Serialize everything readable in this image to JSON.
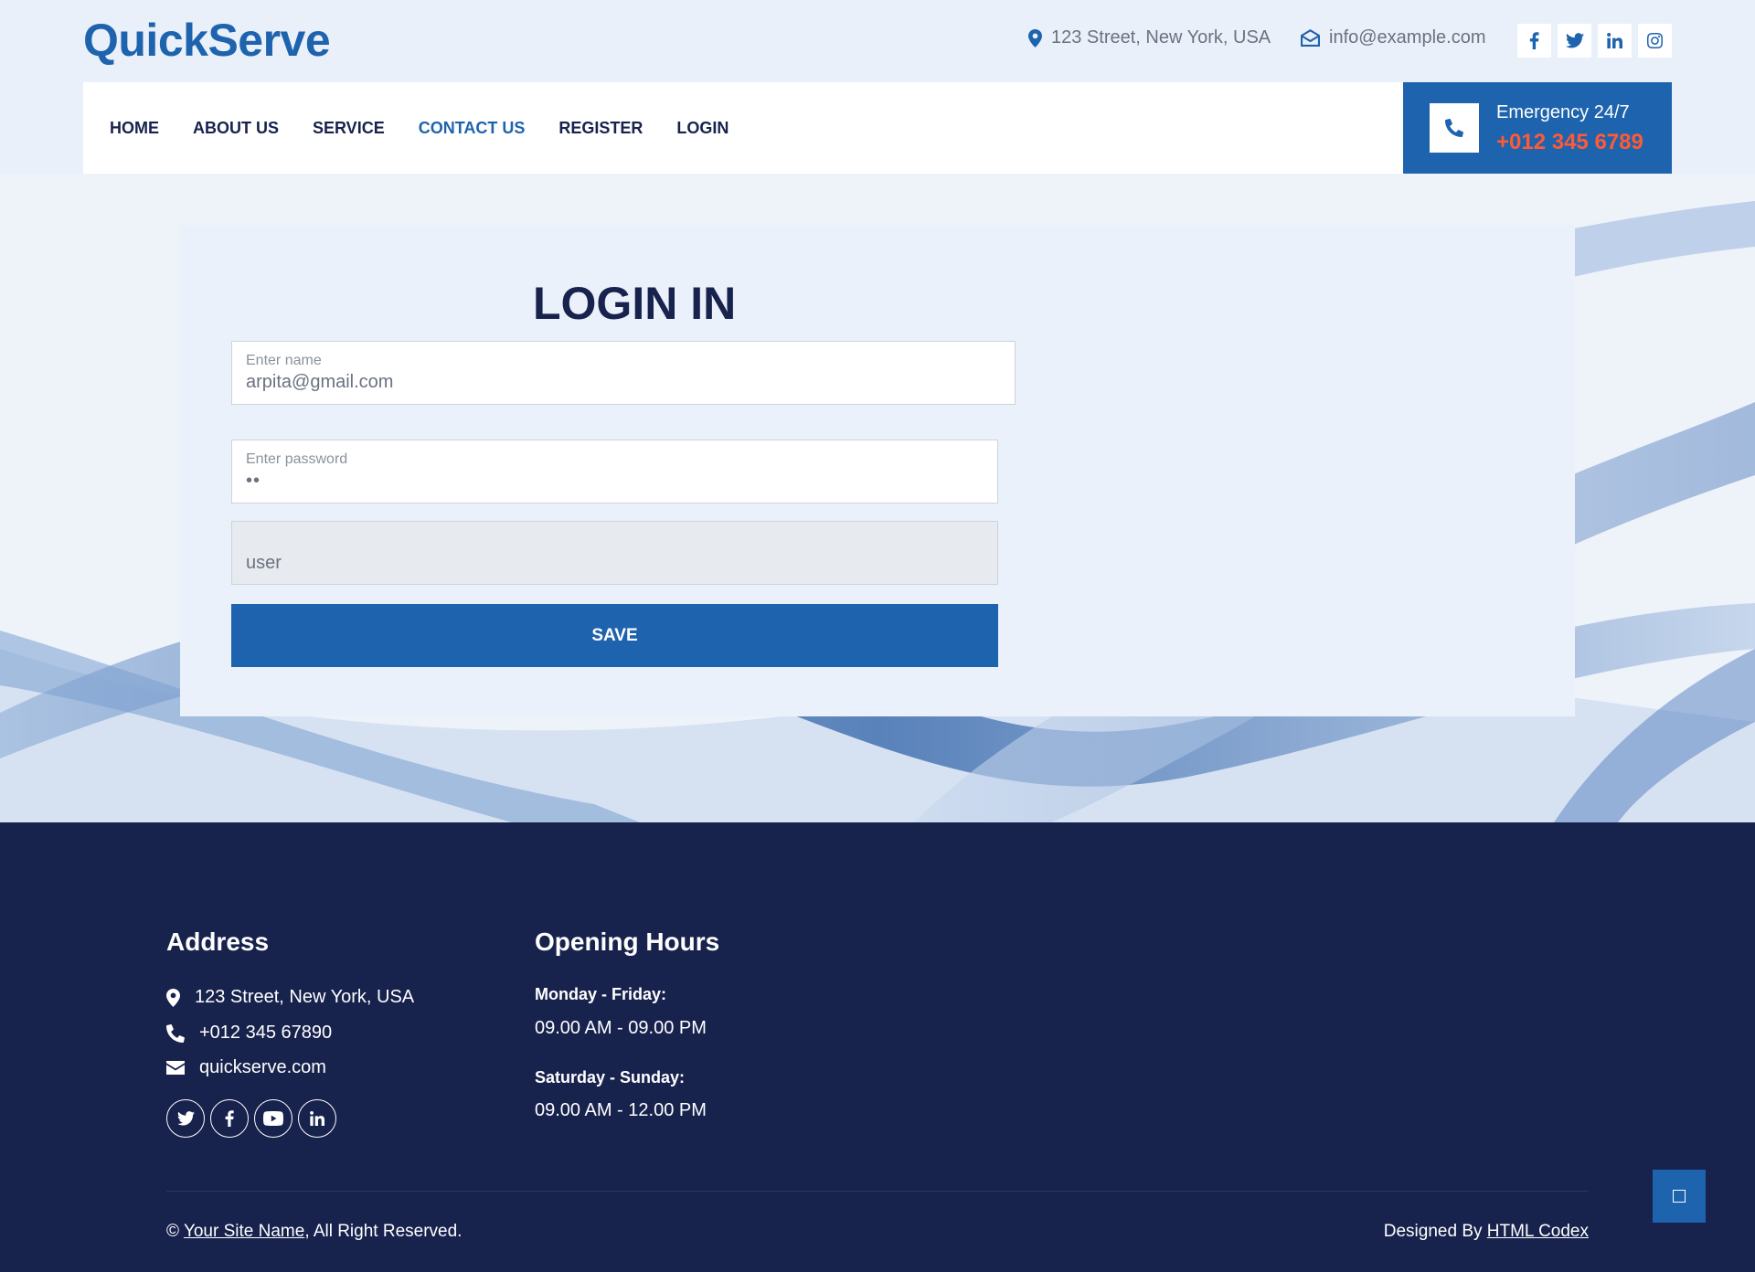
{
  "brand": {
    "name": "QuickServe"
  },
  "top_info": {
    "address": "123 Street, New York, USA",
    "email": "info@example.com",
    "socials": [
      "facebook-icon",
      "twitter-icon",
      "linkedin-icon",
      "instagram-icon"
    ]
  },
  "nav": {
    "items": [
      {
        "label": "HOME",
        "active": false
      },
      {
        "label": "ABOUT US",
        "active": false
      },
      {
        "label": "SERVICE",
        "active": false
      },
      {
        "label": "CONTACT US",
        "active": true
      },
      {
        "label": "REGISTER",
        "active": false
      },
      {
        "label": "LOGIN",
        "active": false
      }
    ]
  },
  "emergency": {
    "label": "Emergency 24/7",
    "phone": "+012 345 6789"
  },
  "login_form": {
    "title": "LOGIN IN",
    "name_label": "Enter name",
    "name_value": "arpita@gmail.com",
    "password_label": "Enter password",
    "password_value": "••",
    "role_value": "user",
    "save_label": "SAVE"
  },
  "footer": {
    "address_title": "Address",
    "address": "123 Street, New York, USA",
    "phone": "+012 345 67890",
    "website": "quickserve.com",
    "socials": [
      "twitter-icon",
      "facebook-icon",
      "youtube-icon",
      "linkedin-icon"
    ],
    "hours_title": "Opening Hours",
    "weekday_label": "Monday - Friday:",
    "weekday_hours": "09.00 AM - 09.00 PM",
    "weekend_label": "Saturday - Sunday:",
    "weekend_hours": "09.00 AM - 12.00 PM",
    "copyright_prefix": "©",
    "site_name_link": "Your Site Name",
    "copyright_suffix": ", All Right Reserved.",
    "designed_prefix": "Designed By",
    "designer_link": "HTML Codex"
  },
  "colors": {
    "primary": "#1e63ad",
    "dark": "#17224d",
    "accent": "#ff5a36"
  }
}
